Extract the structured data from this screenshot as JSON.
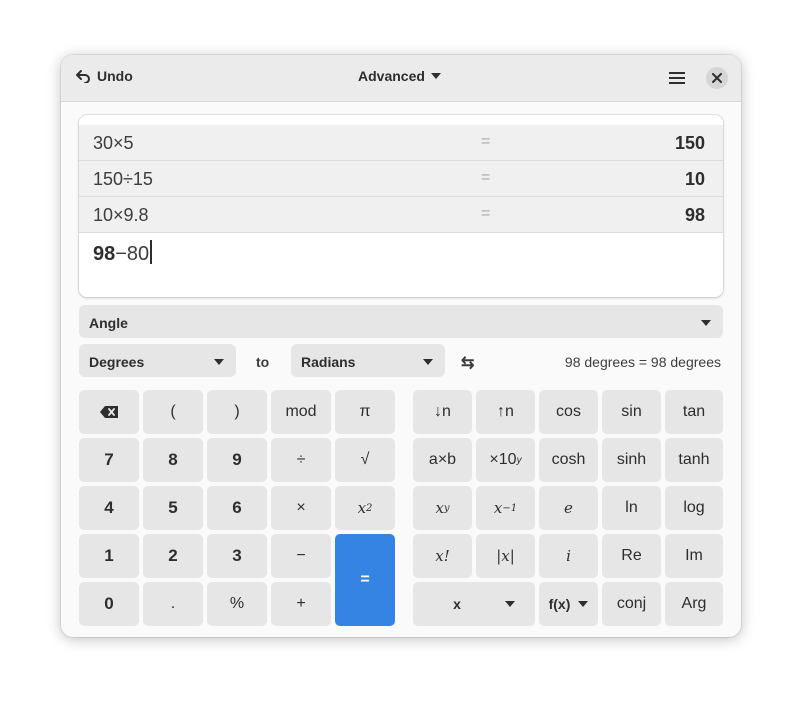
{
  "header": {
    "undo_label": "Undo",
    "mode_label": "Advanced"
  },
  "history": [
    {
      "expr": "30×5",
      "eq": "=",
      "result": "150"
    },
    {
      "expr": "150÷15",
      "eq": "=",
      "result": "10"
    },
    {
      "expr": "10×9.8",
      "eq": "=",
      "result": "98"
    }
  ],
  "entry": {
    "bold_part": "98",
    "rest": "−80"
  },
  "conversion": {
    "category": "Angle",
    "from_unit": "Degrees",
    "to_label": "to",
    "to_unit": "Radians",
    "swap_symbol": "⇆",
    "result": "98 degrees  =  98 degrees"
  },
  "keys": {
    "backspace": "⌫",
    "lparen": "(",
    "rparen": ")",
    "mod": "mod",
    "pi": "π",
    "n7": "7",
    "n8": "8",
    "n9": "9",
    "divide": "÷",
    "sqrt": "√",
    "square_base": "x",
    "square_exp": "2",
    "n4": "4",
    "n5": "5",
    "n6": "6",
    "times": "×",
    "n1": "1",
    "n2": "2",
    "n3": "3",
    "minus": "−",
    "n0": "0",
    "dot": ".",
    "percent": "%",
    "plus": "+",
    "equals": "=",
    "shift_down": "↓n",
    "shift_up": "↑n",
    "cos": "cos",
    "sin": "sin",
    "tan": "tan",
    "axb": "a×b",
    "sci_base": "×10",
    "sci_exp": "y",
    "cosh": "cosh",
    "sinh": "sinh",
    "tanh": "tanh",
    "pow_base": "x",
    "pow_exp": "y",
    "inv_base": "x",
    "inv_exp": "−1",
    "e": "e",
    "ln": "ln",
    "log": "log",
    "factorial": "x!",
    "abs": "|x|",
    "imag": "i",
    "re": "Re",
    "im": "Im",
    "var_x": "x",
    "fx": "f(x)",
    "conj": "conj",
    "arg": "Arg"
  }
}
